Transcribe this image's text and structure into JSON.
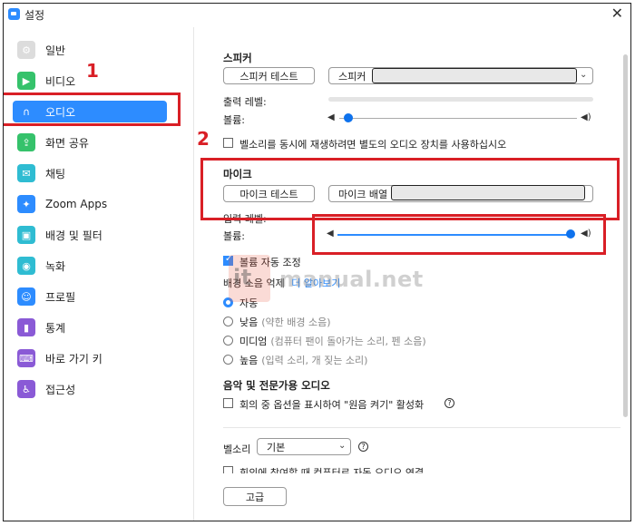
{
  "window": {
    "title": "설정"
  },
  "sidebar": {
    "items": [
      {
        "label": "일반",
        "icon": "gear-icon",
        "color": "#dcdcdc",
        "glyph": "⚙"
      },
      {
        "label": "비디오",
        "icon": "video-icon",
        "color": "#35c26b",
        "glyph": "▶"
      },
      {
        "label": "오디오",
        "icon": "headphones-icon",
        "color": "#2d8cff",
        "glyph": "∩"
      },
      {
        "label": "화면 공유",
        "icon": "screen-share-icon",
        "color": "#35c26b",
        "glyph": "⇪"
      },
      {
        "label": "채팅",
        "icon": "chat-icon",
        "color": "#2fbcd2",
        "glyph": "✉"
      },
      {
        "label": "Zoom Apps",
        "icon": "apps-icon",
        "color": "#2d8cff",
        "glyph": "✦"
      },
      {
        "label": "배경 및 필터",
        "icon": "background-icon",
        "color": "#2fbcd2",
        "glyph": "▣"
      },
      {
        "label": "녹화",
        "icon": "record-icon",
        "color": "#2fbcd2",
        "glyph": "◉"
      },
      {
        "label": "프로필",
        "icon": "profile-icon",
        "color": "#2d8cff",
        "glyph": "☺"
      },
      {
        "label": "통계",
        "icon": "stats-icon",
        "color": "#8a5ad6",
        "glyph": "▮"
      },
      {
        "label": "바로 가기 키",
        "icon": "keyboard-icon",
        "color": "#8a5ad6",
        "glyph": "⌨"
      },
      {
        "label": "접근성",
        "icon": "accessibility-icon",
        "color": "#8a5ad6",
        "glyph": "♿"
      }
    ],
    "active_index": 2
  },
  "speaker": {
    "title": "스피커",
    "test_button": "스피커 테스트",
    "device_select": "스피커",
    "output_level_label": "출력 레벨:",
    "volume_label": "볼륨:",
    "volume_level": 0.04,
    "separate_device_checkbox": "벨소리를 동시에 재생하려면 별도의 오디오 장치를 사용하십시오"
  },
  "mic": {
    "title": "마이크",
    "test_button": "마이크 테스트",
    "device_select": "마이크 배열",
    "input_level_label": "입력 레벨:",
    "volume_label": "볼륨:",
    "volume_level": 1.0,
    "auto_adjust_checkbox": "볼륨 자동 조정"
  },
  "noise": {
    "title": "배경 소음 억제",
    "learn_more": "더 알아보기",
    "options": [
      {
        "label": "자동",
        "hint": ""
      },
      {
        "label": "낮음",
        "hint": "(약한 배경 소음)"
      },
      {
        "label": "미디엄",
        "hint": "(컴퓨터 팬이 돌아가는 소리, 펜 소음)"
      },
      {
        "label": "높음",
        "hint": "(입력 소리, 개 짖는 소리)"
      }
    ],
    "selected_index": 0
  },
  "music": {
    "title": "음악 및 전문가용 오디오",
    "original_sound_checkbox": "회의 중 옵션을 표시하여 \"원음 켜기\" 활성화"
  },
  "ringtone": {
    "label": "벨소리",
    "select": "기본",
    "cut_off_text": "회의에 참여할 때 컴퓨터로 자동 오디오 연결"
  },
  "advanced_button": "고급",
  "annotations": {
    "step1": "1",
    "step2": "2"
  },
  "watermark": {
    "text": "manual.net",
    "logo_text": "it"
  },
  "colors": {
    "accent": "#2d8cff",
    "annotation_red": "#d91f26"
  }
}
